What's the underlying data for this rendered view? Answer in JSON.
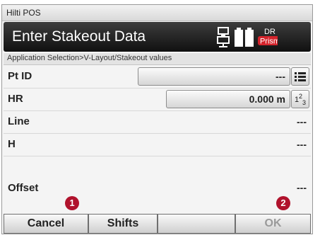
{
  "window": {
    "title": "Hilti POS"
  },
  "header": {
    "title": "Enter Stakeout Data",
    "status_top": "DR",
    "status_bottom": "Prism"
  },
  "breadcrumb": "Application Selection>V-Layout/Stakeout values",
  "fields": {
    "pt_id": {
      "label": "Pt ID",
      "value": "---"
    },
    "hr": {
      "label": "HR",
      "value": "0.000 m",
      "keypad_label_base": "1",
      "keypad_label_sup": "2",
      "keypad_label_sub": "3"
    },
    "line": {
      "label": "Line",
      "value": "---"
    },
    "h": {
      "label": "H",
      "value": "---"
    },
    "offset": {
      "label": "Offset",
      "value": "---"
    }
  },
  "footer": {
    "cancel": "Cancel",
    "shifts": "Shifts",
    "empty": "",
    "ok": "OK"
  },
  "callouts": {
    "one": "1",
    "two": "2"
  },
  "colors": {
    "header_bg": "#1a1a1a",
    "prism_red": "#d4242c",
    "callout": "#b0122c",
    "disabled_text": "#9a9a9a"
  },
  "icons": [
    "instrument-icon",
    "battery-icon",
    "list-icon",
    "keypad-icon"
  ]
}
